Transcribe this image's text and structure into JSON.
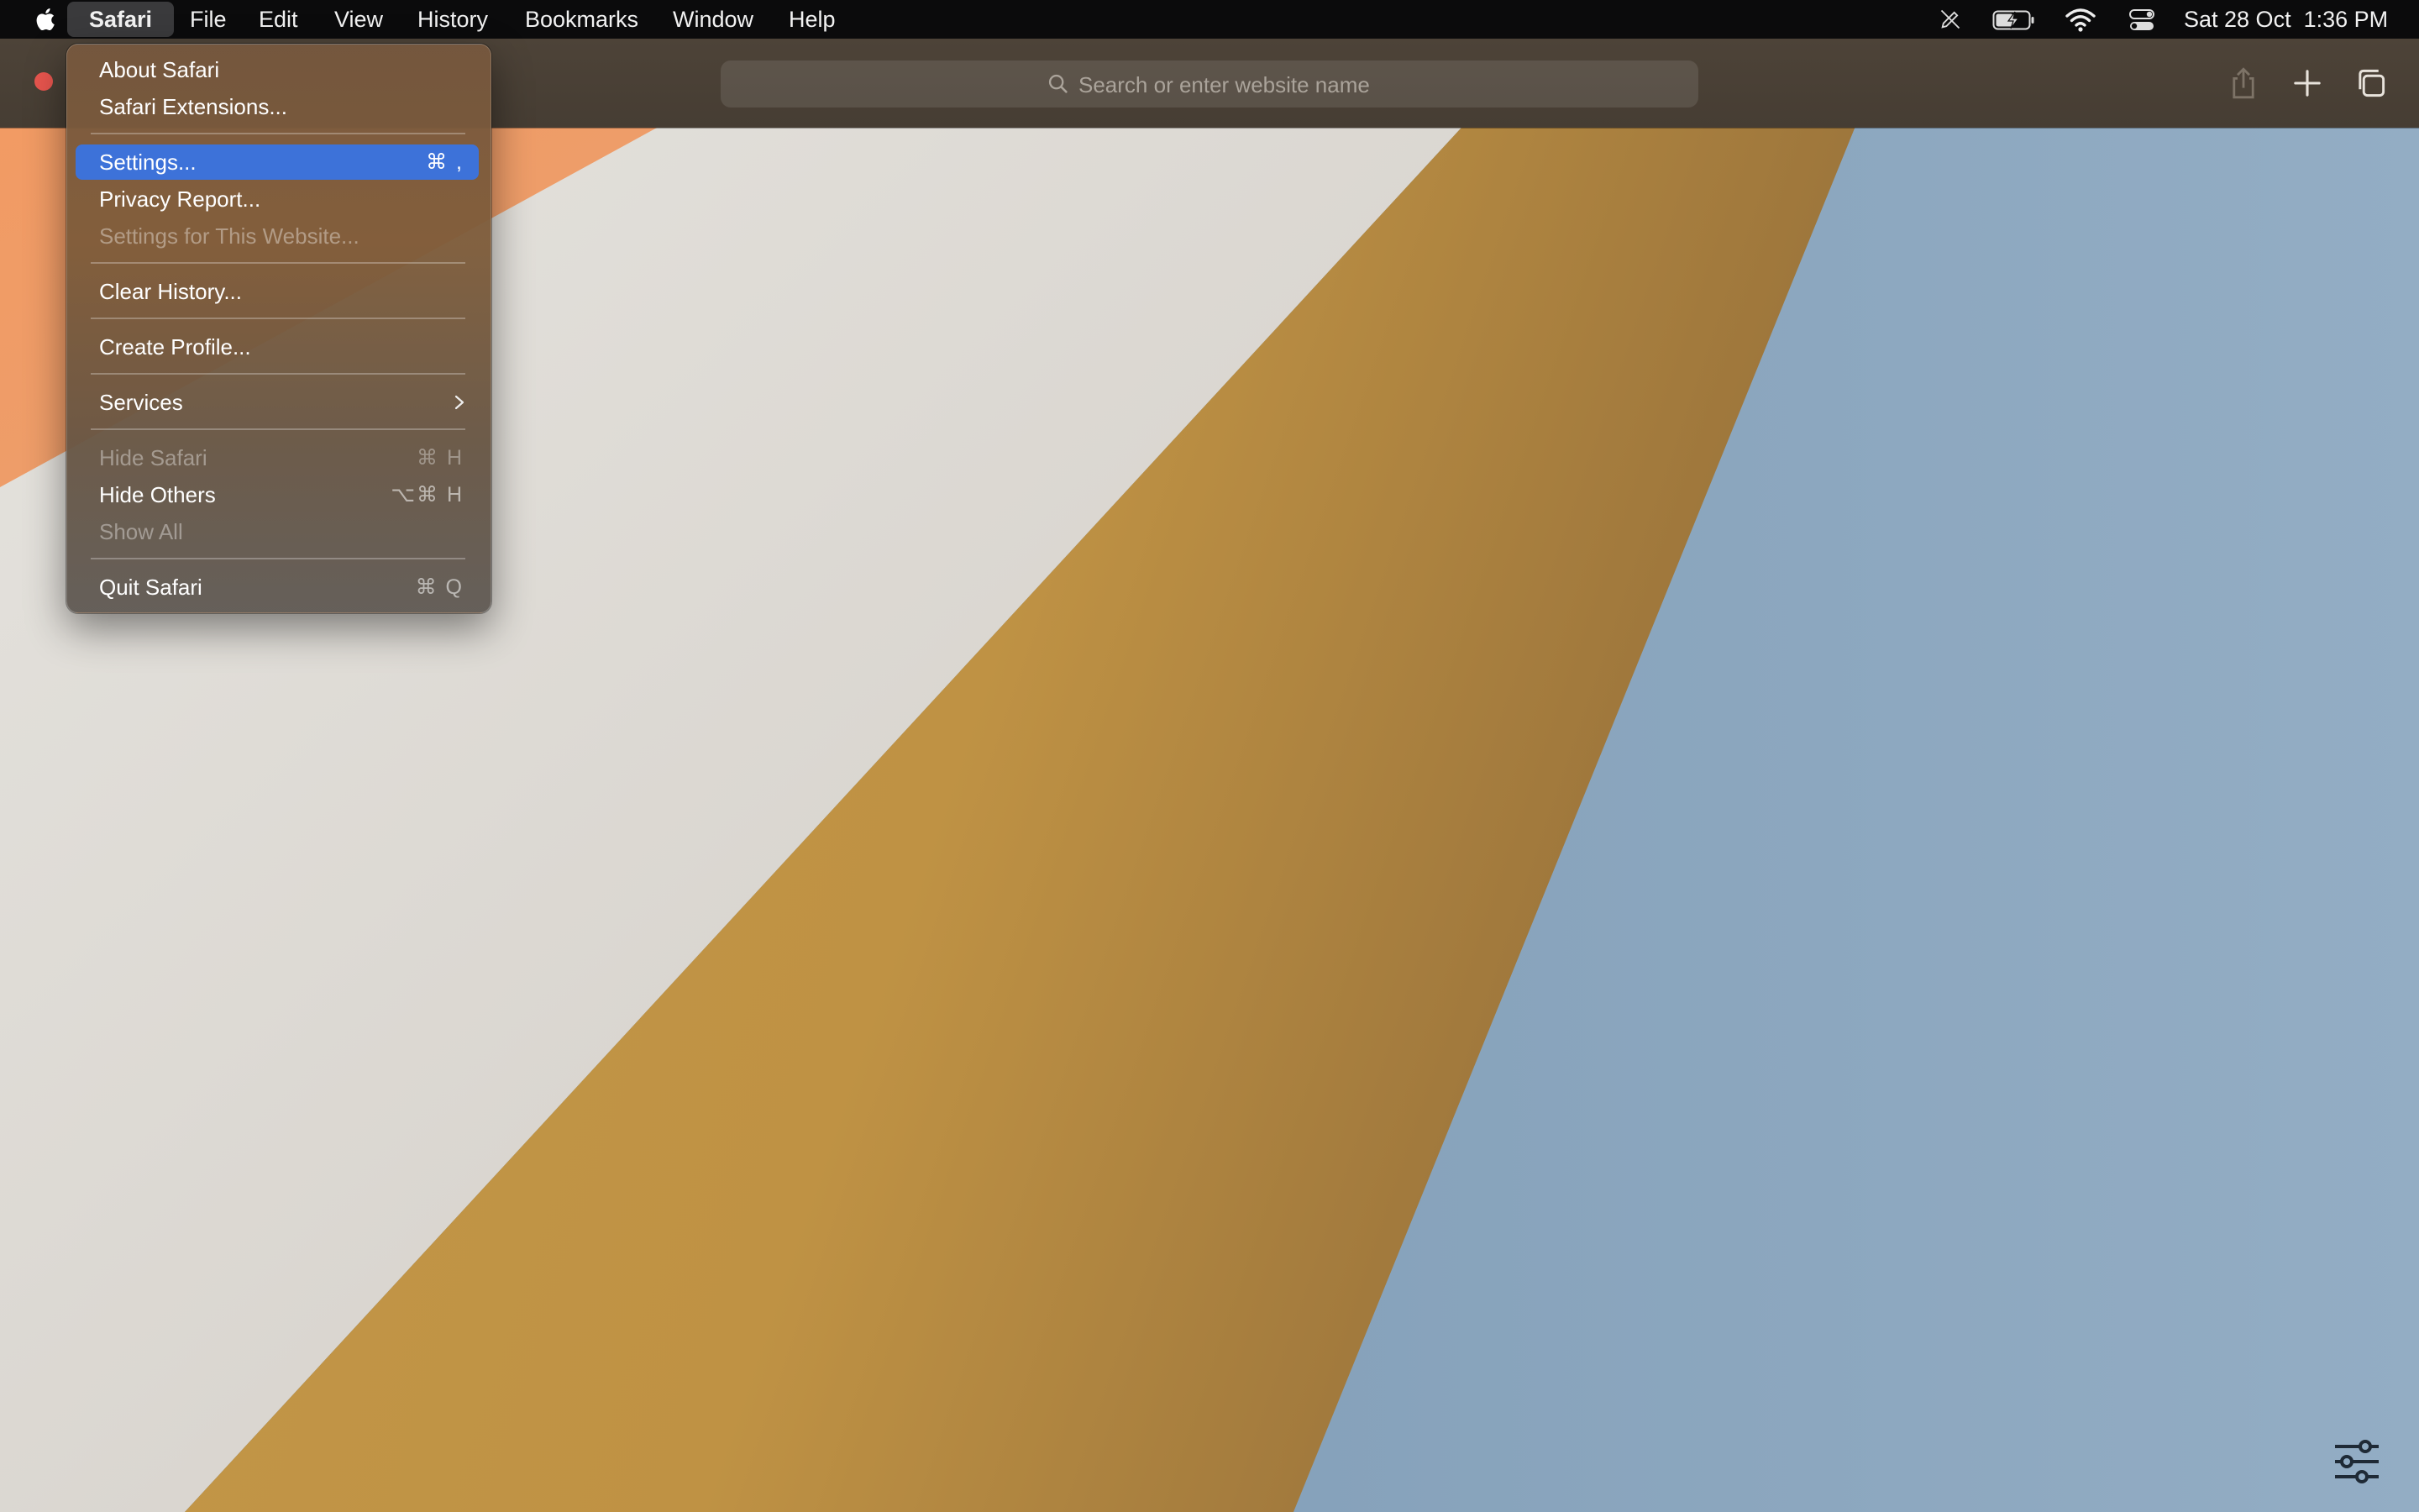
{
  "colors": {
    "menu_highlight": "#3d72d9",
    "close_button": "#e8554e",
    "wallpaper_orange": "#f0a06a",
    "wallpaper_cream": "#dcd8d2",
    "wallpaper_gold": "#bf9244",
    "wallpaper_blue": "#8faac2"
  },
  "menubar": {
    "apple_icon": "apple-logo-icon",
    "items": [
      "Safari",
      "File",
      "Edit",
      "View",
      "History",
      "Bookmarks",
      "Window",
      "Help"
    ],
    "active": "Safari",
    "status_icons": [
      "pencil-off-icon",
      "battery-charging-icon",
      "wifi-icon",
      "control-center-icon"
    ],
    "clock": "Sat 28 Oct  1:36 PM"
  },
  "toolbar": {
    "search_placeholder": "Search or enter website name",
    "icons": [
      "share-icon",
      "new-tab-plus-icon",
      "tab-overview-icon"
    ]
  },
  "safari_menu": {
    "items": [
      {
        "label": "About Safari",
        "shortcut": "",
        "state": "enabled"
      },
      {
        "label": "Safari Extensions...",
        "shortcut": "",
        "state": "enabled"
      },
      {
        "label": "Settings...",
        "shortcut": "⌘ ,",
        "state": "highlighted"
      },
      {
        "label": "Privacy Report...",
        "shortcut": "",
        "state": "enabled"
      },
      {
        "label": "Settings for This Website...",
        "shortcut": "",
        "state": "disabled"
      },
      {
        "label": "Clear History...",
        "shortcut": "",
        "state": "enabled"
      },
      {
        "label": "Create Profile...",
        "shortcut": "",
        "state": "enabled"
      },
      {
        "label": "Services",
        "shortcut": "",
        "state": "submenu"
      },
      {
        "label": "Hide Safari",
        "shortcut": "⌘ H",
        "state": "disabled"
      },
      {
        "label": "Hide Others",
        "shortcut": "⌥⌘ H",
        "state": "enabled"
      },
      {
        "label": "Show All",
        "shortcut": "",
        "state": "disabled"
      },
      {
        "label": "Quit Safari",
        "shortcut": "⌘ Q",
        "state": "enabled"
      }
    ]
  },
  "page": {
    "customize_icon": "sliders-icon"
  }
}
